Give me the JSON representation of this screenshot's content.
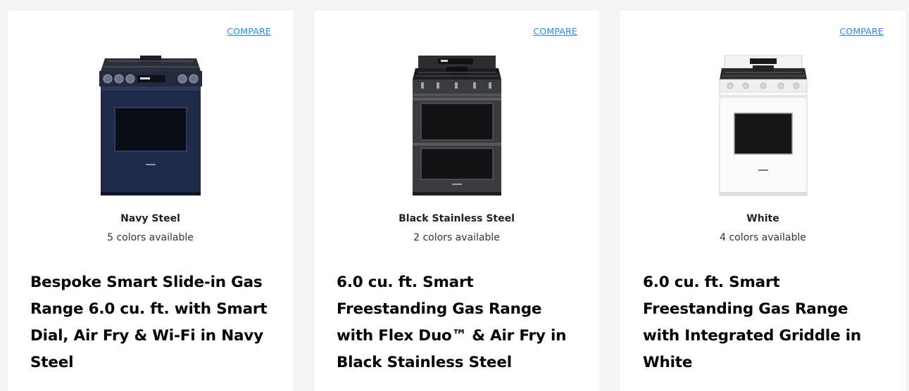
{
  "products": [
    {
      "compare_label": "COMPARE",
      "color_name": "Navy Steel",
      "colors_available": "5 colors available",
      "title": "Bespoke Smart Slide-in Gas Range 6.0 cu. ft. with Smart Dial, Air Fry & Wi-Fi in Navy Steel",
      "finish": "navy"
    },
    {
      "compare_label": "COMPARE",
      "color_name": "Black Stainless Steel",
      "colors_available": "2 colors available",
      "title": "6.0 cu. ft. Smart Freestanding Gas Range with Flex Duo™ & Air Fry in Black Stainless Steel",
      "finish": "black"
    },
    {
      "compare_label": "COMPARE",
      "color_name": "White",
      "colors_available": "4 colors available",
      "title": "6.0 cu. ft. Smart Freestanding Gas Range with Integrated Griddle in White",
      "finish": "white"
    }
  ],
  "colors": {
    "link": "#2189ff",
    "page_bg": "#f4f4f4",
    "card_bg": "#ffffff"
  }
}
